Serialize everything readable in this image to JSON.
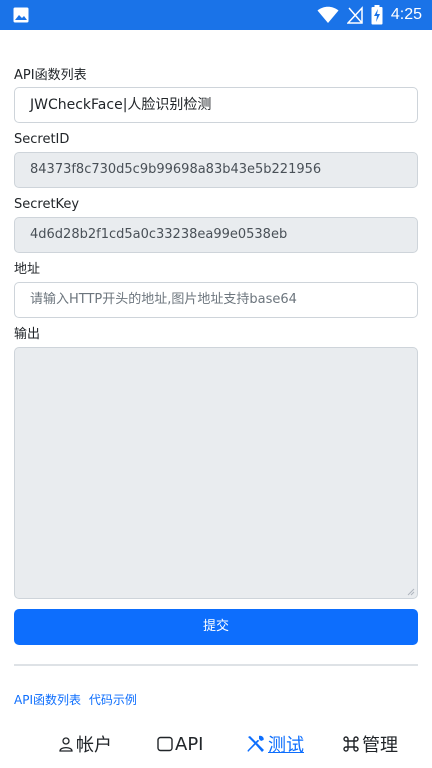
{
  "statusbar": {
    "time": "4:25"
  },
  "form": {
    "api_label": "API函数列表",
    "api_selected": "JWCheckFace|人脸识别检测",
    "secret_id_label": "SecretID",
    "secret_id_value": "84373f8c730d5c9b99698a83b43e5b221956",
    "secret_key_label": "SecretKey",
    "secret_key_value": "4d6d28b2f1cd5a0c33238ea99e0538eb",
    "address_label": "地址",
    "address_placeholder": "请输入HTTP开头的地址,图片地址支持base64",
    "output_label": "输出",
    "submit_label": "提交"
  },
  "links": [
    "API函数列表",
    "代码示例"
  ],
  "tabs": [
    {
      "label": "帐户",
      "icon": "person-icon"
    },
    {
      "label": "API",
      "icon": "square-icon"
    },
    {
      "label": "测试",
      "icon": "tools-icon",
      "active": true
    },
    {
      "label": "管理",
      "icon": "command-icon"
    }
  ],
  "colors": {
    "accent": "#0d6efd",
    "statusbar": "#1a73e8"
  }
}
